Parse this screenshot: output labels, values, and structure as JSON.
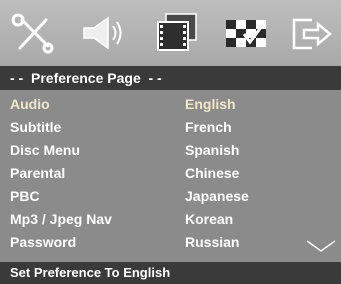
{
  "toolbar": {
    "icons": [
      "tools-icon",
      "speaker-icon",
      "video-film-icon",
      "checkered-flag-icon",
      "exit-arrow-icon"
    ]
  },
  "header": {
    "title": "- -  Preference Page  - -"
  },
  "menu": {
    "items": [
      {
        "label": "Audio",
        "value": "English",
        "active": true
      },
      {
        "label": "Subtitle",
        "value": "French"
      },
      {
        "label": "Disc Menu",
        "value": "Spanish"
      },
      {
        "label": "Parental",
        "value": "Chinese"
      },
      {
        "label": "PBC",
        "value": "Japanese"
      },
      {
        "label": "Mp3 / Jpeg Nav",
        "value": "Korean"
      },
      {
        "label": "Password",
        "value": "Russian"
      }
    ]
  },
  "footer": {
    "status": "Set Preference To English"
  },
  "colors": {
    "panel": "#8b8b8b",
    "bar": "#3a3a3a",
    "active_text": "#f2e6c8"
  }
}
